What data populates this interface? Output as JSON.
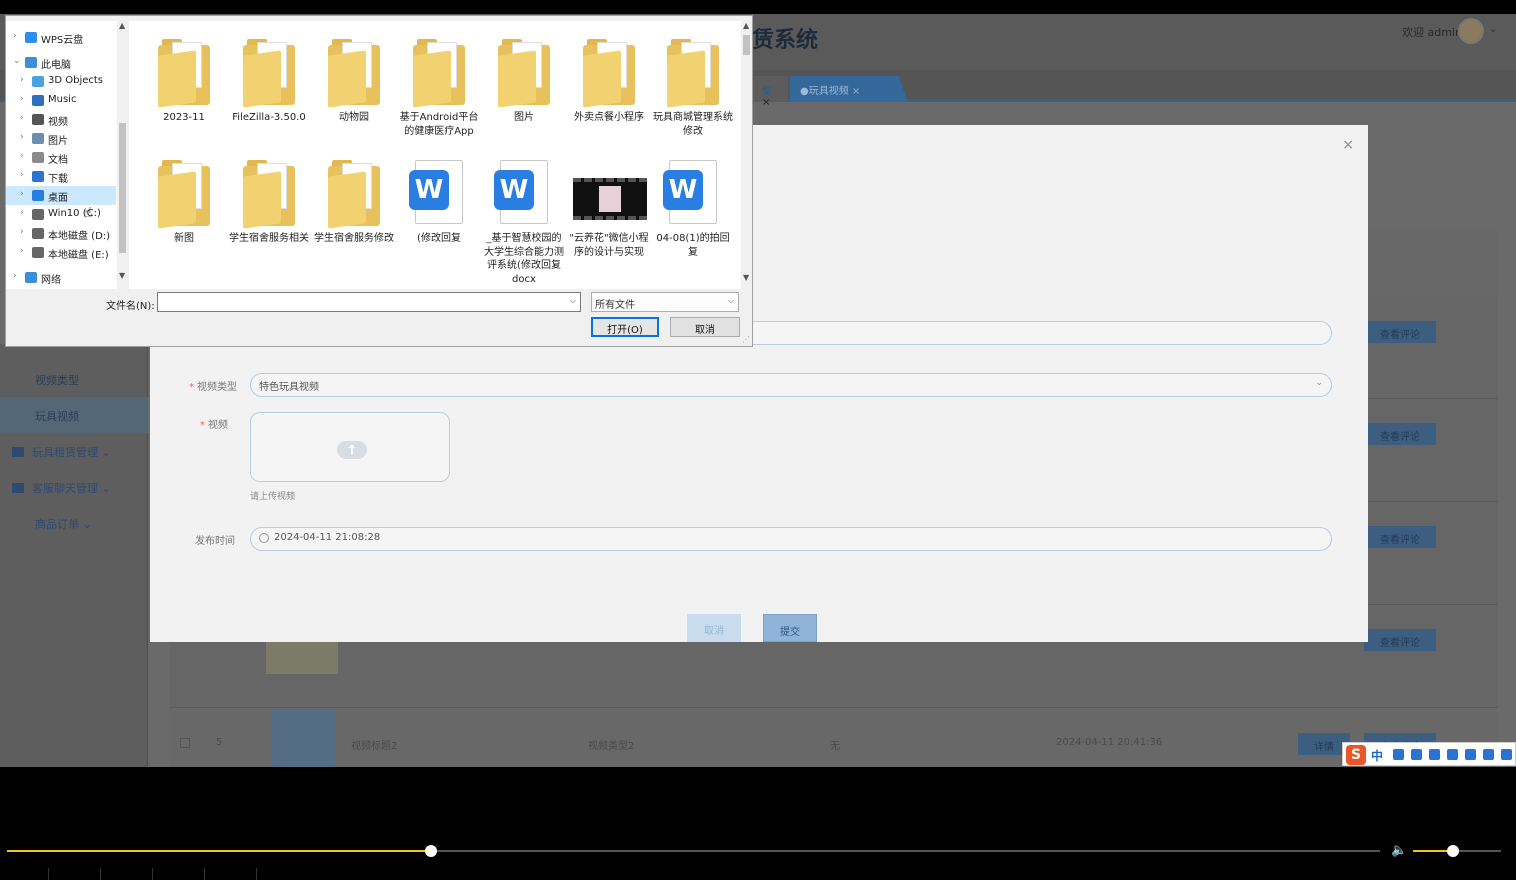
{
  "app": {
    "title": "赁系统",
    "welcome": "欢迎 admin",
    "tabs": [
      {
        "label": "型"
      },
      {
        "label": "●玩具视频"
      }
    ]
  },
  "sidebar": {
    "items": [
      {
        "label": "视频类型"
      },
      {
        "label": "玩具视频"
      },
      {
        "label": "玩具租赁管理"
      },
      {
        "label": "客服聊天管理"
      },
      {
        "label": "商品订单"
      }
    ]
  },
  "list": {
    "review_label": "查看评论",
    "detail_label": "详情",
    "last_row": {
      "index": "5",
      "title": "视频标题2",
      "type": "视频类型2",
      "remark": "无",
      "time": "2024-04-11 20:41:36"
    }
  },
  "modal": {
    "close": "×",
    "type_label": "视频类型",
    "type_value": "特色玩具视频",
    "video_label": "视频",
    "upload_hint": "请上传视频",
    "pubtime_label": "发布时间",
    "pubtime_value": "2024-04-11 21:08:28",
    "cancel": "取消",
    "submit": "提交"
  },
  "file_dialog": {
    "nav": [
      {
        "label": "WPS云盘",
        "icon": "cloud-icon",
        "color": "#2f8cf0"
      },
      {
        "label": "此电脑",
        "icon": "computer-icon",
        "color": "#3a8fd8"
      },
      {
        "label": "3D Objects",
        "icon": "cube-icon",
        "color": "#4aa3df"
      },
      {
        "label": "Music",
        "icon": "music-icon",
        "color": "#2e6fc0"
      },
      {
        "label": "视频",
        "icon": "film-icon",
        "color": "#555"
      },
      {
        "label": "图片",
        "icon": "pictures-icon",
        "color": "#6c8cb0"
      },
      {
        "label": "文档",
        "icon": "document-icon",
        "color": "#8a8a8a"
      },
      {
        "label": "下载",
        "icon": "download-icon",
        "color": "#2a73d1"
      },
      {
        "label": "桌面",
        "icon": "desktop-icon",
        "color": "#2a7de1"
      },
      {
        "label": "Win10 (C:)",
        "icon": "drive-icon",
        "color": "#666"
      },
      {
        "label": "本地磁盘 (D:)",
        "icon": "drive-icon",
        "color": "#666"
      },
      {
        "label": "本地磁盘 (E:)",
        "icon": "drive-icon",
        "color": "#666"
      },
      {
        "label": "网络",
        "icon": "network-icon",
        "color": "#3a8fd8"
      }
    ],
    "files": [
      {
        "name": "2023-11",
        "kind": "folder"
      },
      {
        "name": "FileZilla-3.50.0",
        "kind": "folder"
      },
      {
        "name": "动物园",
        "kind": "folder"
      },
      {
        "name": "基于Android平台的健康医疗App",
        "kind": "folder"
      },
      {
        "name": "图片",
        "kind": "folder"
      },
      {
        "name": "外卖点餐小程序",
        "kind": "folder"
      },
      {
        "name": "玩具商城管理系统修改",
        "kind": "folder"
      },
      {
        "name": "新图",
        "kind": "folder"
      },
      {
        "name": "学生宿舍服务相关",
        "kind": "folder"
      },
      {
        "name": "学生宿舍服务修改",
        "kind": "folder"
      },
      {
        "name": "(修改回复",
        "kind": "wps"
      },
      {
        "name": "_基于智慧校园的大学生综合能力测评系统(修改回复docx",
        "kind": "wps"
      },
      {
        "name": "\"云养花\"微信小程序的设计与实现",
        "kind": "video"
      },
      {
        "name": "04-08(1)的拍回复",
        "kind": "wps"
      }
    ],
    "filename_label": "文件名(N):",
    "filename_value": "",
    "filetype": "所有文件",
    "open": "打开(O)",
    "cancel": "取消"
  },
  "ime": {
    "logo": "S",
    "lang": "中"
  },
  "player": {
    "progress": 0.3086,
    "volume": 0.45
  }
}
